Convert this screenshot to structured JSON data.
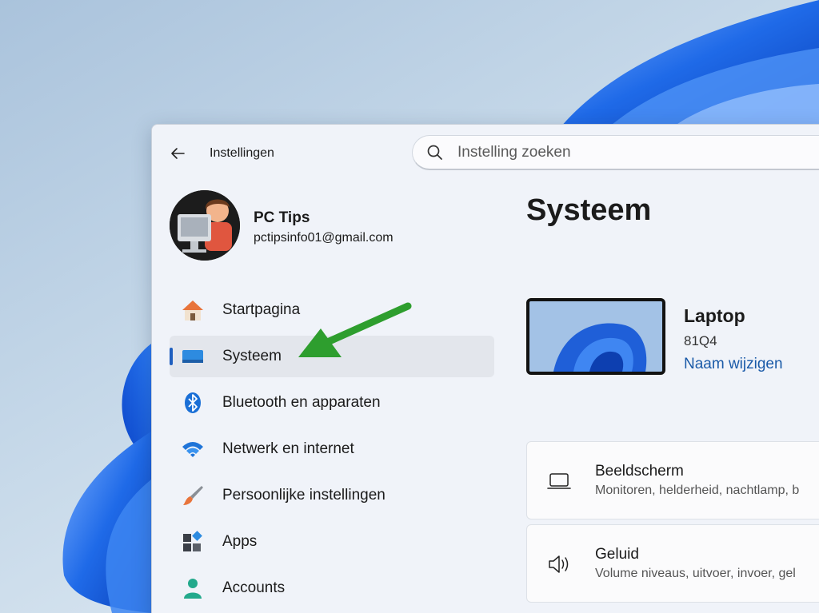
{
  "window": {
    "title": "Instellingen",
    "back_icon": "back-arrow-icon"
  },
  "search": {
    "placeholder": "Instelling zoeken",
    "icon": "search-icon"
  },
  "profile": {
    "name": "PC Tips",
    "email": "pctipsinfo01@gmail.com"
  },
  "sidebar": {
    "items": [
      {
        "label": "Startpagina",
        "icon": "home-icon",
        "selected": false
      },
      {
        "label": "Systeem",
        "icon": "monitor-icon",
        "selected": true
      },
      {
        "label": "Bluetooth en apparaten",
        "icon": "bluetooth-icon",
        "selected": false
      },
      {
        "label": "Netwerk en internet",
        "icon": "wifi-icon",
        "selected": false
      },
      {
        "label": "Persoonlijke instellingen",
        "icon": "paintbrush-icon",
        "selected": false
      },
      {
        "label": "Apps",
        "icon": "apps-icon",
        "selected": false
      },
      {
        "label": "Accounts",
        "icon": "person-icon",
        "selected": false
      }
    ]
  },
  "main": {
    "title": "Systeem",
    "device": {
      "name": "Laptop",
      "model": "81Q4",
      "rename_label": "Naam wijzigen"
    },
    "cards": [
      {
        "title": "Beeldscherm",
        "subtitle": "Monitoren, helderheid, nachtlamp, b",
        "icon": "laptop-icon"
      },
      {
        "title": "Geluid",
        "subtitle": "Volume niveaus, uitvoer, invoer, gel",
        "icon": "speaker-icon"
      }
    ]
  },
  "colors": {
    "accent": "#1f5fbf",
    "link": "#1a5aa8",
    "annotation_arrow": "#2e9e2e"
  }
}
